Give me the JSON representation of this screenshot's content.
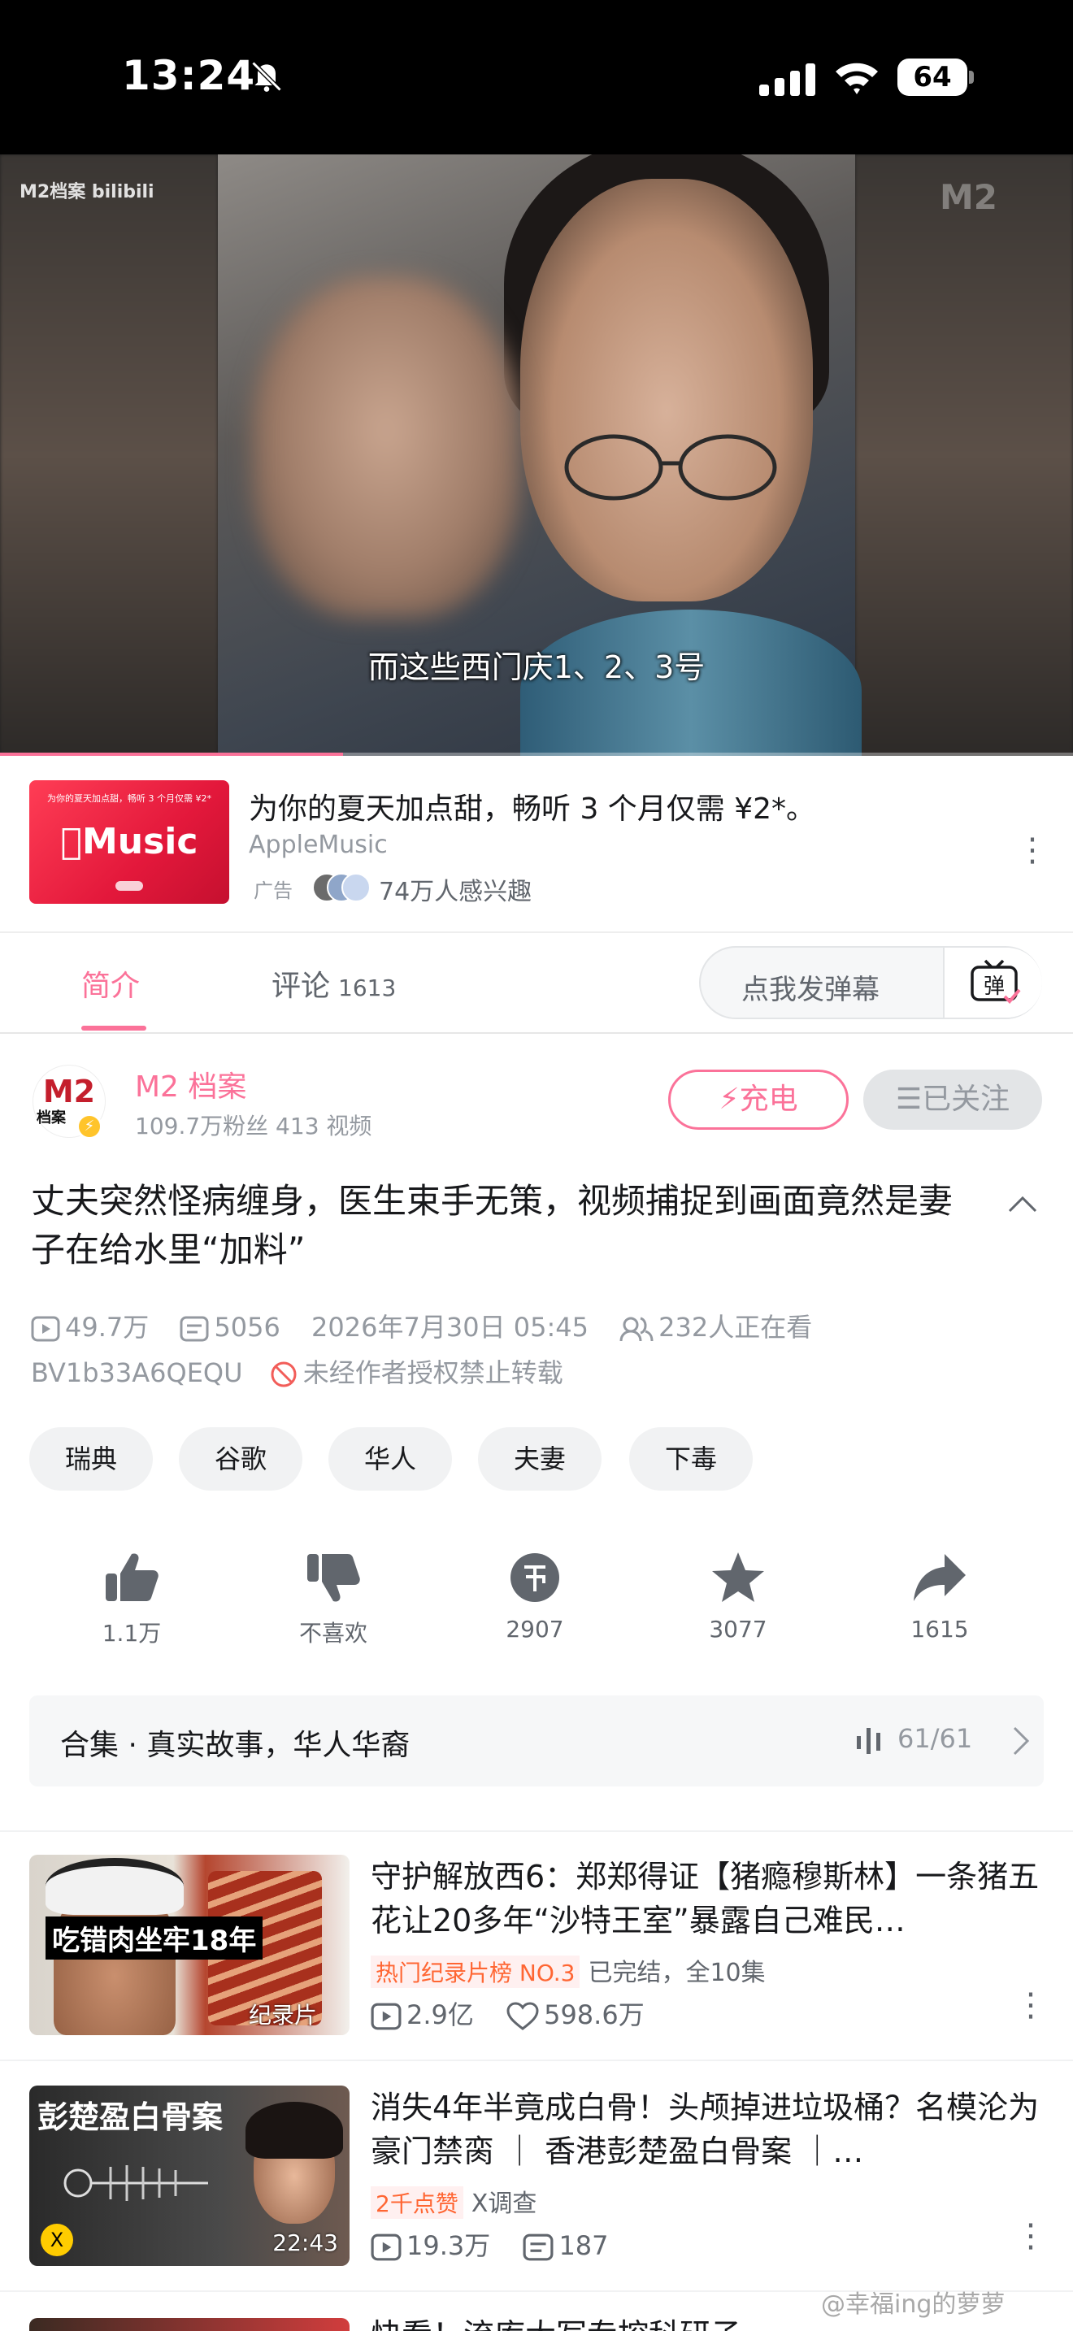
{
  "status_bar": {
    "time": "13:24",
    "battery": "64"
  },
  "video": {
    "logo_left": "M2档案 bilibili",
    "logo_right": "M2",
    "subtitle": "而这些西门庆1、2、3号",
    "progress": 0.32
  },
  "ad": {
    "thumb_top": "为你的夏天加点甜，畅听 3 个月仅需 ¥2*",
    "thumb_logo": "Music",
    "title": "为你的夏天加点甜，畅听 3 个月仅需 ¥2*。",
    "brand": "AppleMusic",
    "tag": "广告",
    "interest": "74万人感兴趣"
  },
  "tabs": {
    "intro": "简介",
    "comment": "评论",
    "comment_count": "1613",
    "danmaku_placeholder": "点我发弹幕",
    "danmaku_toggle": "弹"
  },
  "uploader": {
    "avatar_text": "M2",
    "avatar_sub": "档案",
    "name": "M2 档案",
    "stats": "109.7万粉丝  413 视频",
    "charge": "充电",
    "follow": "已关注"
  },
  "video_info": {
    "title": "丈夫突然怪病缠身，医生束手无策，视频捕捉到画面竟然是妻子在给水里“加料”",
    "views": "49.7万",
    "danmaku": "5056",
    "date": "2026年7月30日 05:45",
    "watching": "232人正在看",
    "bvid": "BV1b33A6QEQU",
    "copyright": "未经作者授权禁止转载"
  },
  "tags": [
    "瑞典",
    "谷歌",
    "华人",
    "夫妻",
    "下毒"
  ],
  "actions": {
    "like": "1.1万",
    "dislike": "不喜欢",
    "coin": "2907",
    "favorite": "3077",
    "share": "1615"
  },
  "collection": {
    "title": "合集 · 真实故事，华人华裔",
    "count": "61/61"
  },
  "related": [
    {
      "title": "守护解放西6：郑郑得证【猪瘾穆斯林】一条猪五花让20多年“沙特王室”暴露自己难民…",
      "thumb_text": "吃错肉坐牢18年",
      "thumb_label": "纪录片",
      "badge": "热门纪录片榜 NO.3",
      "badge_extra": "已完结，全10集",
      "views": "2.9亿",
      "likes": "598.6万"
    },
    {
      "title": "消失4年半竟成白骨！头颅掉进垃圾桶？名模沦为豪门禁脔 ｜ 香港彭楚盈白骨案 ｜…",
      "thumb_text": "彭楚盈白骨案",
      "duration": "22:43",
      "badge": "2千点赞",
      "badge_extra": "X调查",
      "views": "19.3万",
      "danmaku": "187"
    }
  ],
  "watermark": "@幸福ing的萝萝",
  "peek_title": "快看！流库大写专控科研子"
}
